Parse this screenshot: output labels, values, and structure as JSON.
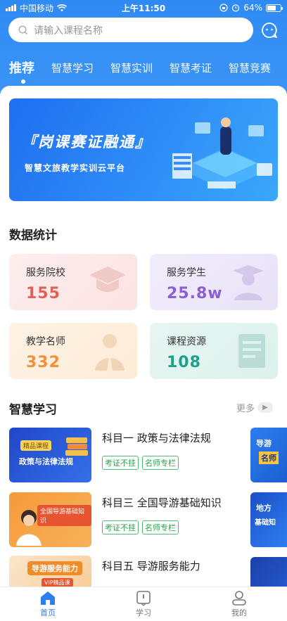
{
  "status_bar": {
    "carrier": "中国移动",
    "time": "上午11:50",
    "battery": "64%",
    "battery_level": 0.64
  },
  "search": {
    "placeholder": "请输入课程名称"
  },
  "tabs": [
    {
      "label": "推荐",
      "active": true
    },
    {
      "label": "智慧学习"
    },
    {
      "label": "智慧实训"
    },
    {
      "label": "智慧考证"
    },
    {
      "label": "智慧竞赛"
    }
  ],
  "banner": {
    "title": "『岗课赛证融通』",
    "subtitle": "智慧文旅教学实训云平台"
  },
  "stats_section": {
    "title": "数据统计"
  },
  "stats": [
    {
      "label": "服务院校",
      "value": "155",
      "color": "#e0605a"
    },
    {
      "label": "服务学生",
      "value": "25.8w",
      "color": "#8a5fd6"
    },
    {
      "label": "教学名师",
      "value": "332",
      "color": "#f0913a"
    },
    {
      "label": "课程资源",
      "value": "108",
      "color": "#1fa08c"
    }
  ],
  "learning_section": {
    "title": "智慧学习",
    "more": "更多"
  },
  "courses": [
    {
      "title": "科目一 政策与法律法规",
      "tags": [
        "考证不挂",
        "名师专栏"
      ],
      "thumb_badge": "精品课程",
      "thumb_text": "政策与法律法规"
    },
    {
      "title": "科目三 全国导游基础知识",
      "tags": [
        "考证不挂",
        "名师专栏"
      ],
      "thumb_text": "全国导游基础知识"
    },
    {
      "title": "科目五 导游服务能力",
      "tags": [],
      "thumb_text": "导游服务能力",
      "thumb_badge": "VIP精品课"
    }
  ],
  "side_thumbs": [
    "导游",
    "名师",
    "地方",
    "基础知"
  ],
  "bottom_nav": [
    {
      "label": "首页",
      "active": true
    },
    {
      "label": "学习"
    },
    {
      "label": "我的"
    }
  ]
}
